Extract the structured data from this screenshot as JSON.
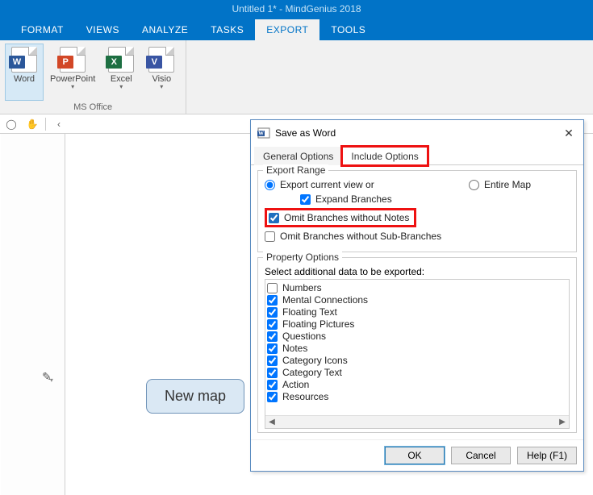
{
  "window": {
    "title": "Untitled 1* - MindGenius 2018"
  },
  "tabs": {
    "items": [
      "FORMAT",
      "VIEWS",
      "ANALYZE",
      "TASKS",
      "EXPORT",
      "TOOLS"
    ],
    "active_index": 4
  },
  "ribbon": {
    "group_label": "MS Office",
    "buttons": [
      {
        "label": "Word",
        "badge": "W",
        "badge_class": "badge-word",
        "selected": true,
        "has_chevron": false
      },
      {
        "label": "PowerPoint",
        "badge": "P",
        "badge_class": "badge-ppt",
        "selected": false,
        "has_chevron": true
      },
      {
        "label": "Excel",
        "badge": "X",
        "badge_class": "badge-xls",
        "selected": false,
        "has_chevron": true
      },
      {
        "label": "Visio",
        "badge": "V",
        "badge_class": "badge-vis",
        "selected": false,
        "has_chevron": true
      }
    ]
  },
  "sub_toolbar": {
    "left_chevron": "‹"
  },
  "canvas": {
    "node_label": "New map"
  },
  "dialog": {
    "title": "Save as Word",
    "tabs": {
      "general": "General Options",
      "include": "Include Options",
      "active": "include"
    },
    "export_range": {
      "legend": "Export Range",
      "radio_current": "Export current view or",
      "radio_entire": "Entire Map",
      "selected": "current",
      "expand_label": "Expand Branches",
      "expand_checked": true,
      "omit_notes_label": "Omit Branches without Notes",
      "omit_notes_checked": true,
      "omit_sub_label": "Omit Branches without Sub-Branches",
      "omit_sub_checked": false
    },
    "property_options": {
      "legend": "Property Options",
      "instruction": "Select additional data to be exported:",
      "items": [
        {
          "label": "Numbers",
          "checked": false
        },
        {
          "label": "Mental Connections",
          "checked": true
        },
        {
          "label": "Floating Text",
          "checked": true
        },
        {
          "label": "Floating Pictures",
          "checked": true
        },
        {
          "label": "Questions",
          "checked": true
        },
        {
          "label": "Notes",
          "checked": true
        },
        {
          "label": "Category Icons",
          "checked": true
        },
        {
          "label": "Category Text",
          "checked": true
        },
        {
          "label": "Action",
          "checked": true
        },
        {
          "label": "Resources",
          "checked": true
        }
      ]
    },
    "buttons": {
      "ok": "OK",
      "cancel": "Cancel",
      "help": "Help (F1)"
    }
  }
}
